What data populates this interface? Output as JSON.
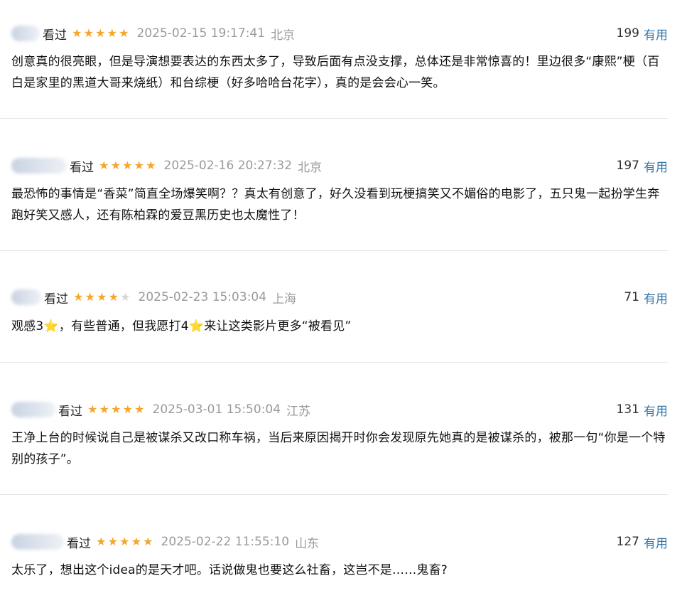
{
  "vote_label": "有用",
  "colors": {
    "star": "#f4a72b",
    "vote_link": "#3377aa",
    "meta_gray": "#9a9a9a",
    "divider": "#e5e5e5"
  },
  "comments": [
    {
      "status": "看过",
      "rating": 5,
      "time": "2025-02-15 19:17:41",
      "location": "北京",
      "votes": "199",
      "content": "创意真的很亮眼，但是导演想要表达的东西太多了，导致后面有点没支撑，总体还是非常惊喜的！里边很多“康熙”梗（百白是家里的黑道大哥来烧纸）和台综梗（好多哈哈台花字），真的是会会心一笑。"
    },
    {
      "status": "看过",
      "rating": 5,
      "time": "2025-02-16 20:27:32",
      "location": "北京",
      "votes": "197",
      "content": "最恐怖的事情是“香菜”简直全场爆笑啊？？真太有创意了，好久没看到玩梗搞笑又不媚俗的电影了，五只鬼一起扮学生奔跑好笑又感人，还有陈柏霖的爱豆黑历史也太魔性了！"
    },
    {
      "status": "看过",
      "rating": 4,
      "time": "2025-02-23 15:03:04",
      "location": "上海",
      "votes": "71",
      "content_parts": [
        "观感3",
        "，有些普通，但我愿打4",
        "来让这类影片更多“被看见”"
      ],
      "inline_icon": "star-emoji"
    },
    {
      "status": "看过",
      "rating": 5,
      "time": "2025-03-01 15:50:04",
      "location": "江苏",
      "votes": "131",
      "content": "王净上台的时候说自己是被谋杀又改口称车祸，当后来原因揭开时你会发现原先她真的是被谋杀的，被那一句“你是一个特别的孩子”。"
    },
    {
      "status": "看过",
      "rating": 5,
      "time": "2025-02-22 11:55:10",
      "location": "山东",
      "votes": "127",
      "content": "太乐了，想出这个idea的是天才吧。话说做鬼也要这么社畜，这岂不是……鬼畜?"
    }
  ]
}
